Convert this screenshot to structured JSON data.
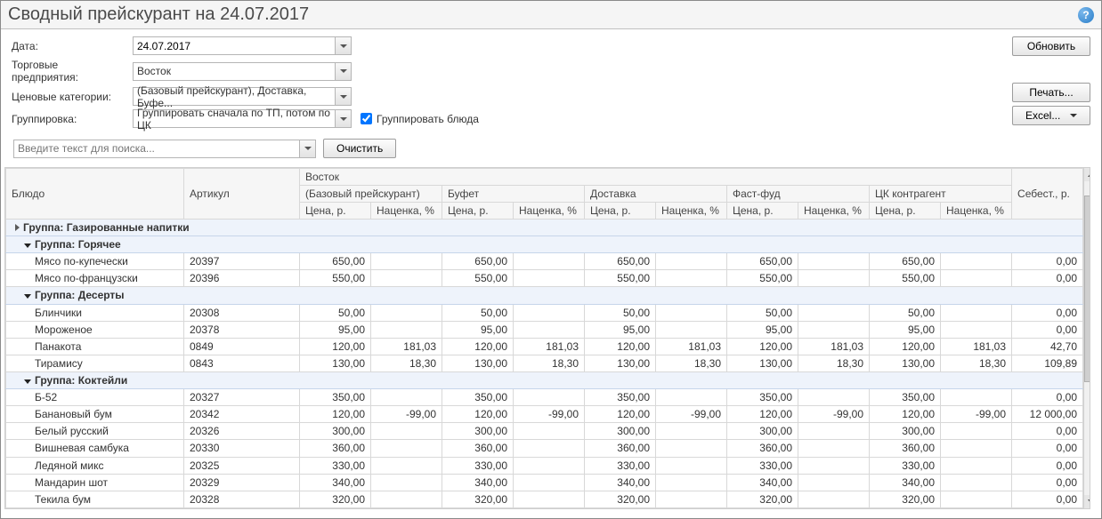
{
  "title": "Сводный прейскурант на 24.07.2017",
  "filters": {
    "date_label": "Дата:",
    "date_value": "24.07.2017",
    "enterprise_label": "Торговые предприятия:",
    "enterprise_value": "Восток",
    "pricecat_label": "Ценовые категории:",
    "pricecat_value": "(Базовый прейскурант), Доставка, Буфе...",
    "grouping_label": "Группировка:",
    "grouping_value": "Группировать сначала по ТП, потом по ЦК",
    "group_dishes_label": "Группировать блюда"
  },
  "buttons": {
    "refresh": "Обновить",
    "print": "Печать...",
    "excel": "Excel...",
    "clear": "Очистить"
  },
  "search": {
    "placeholder": "Введите текст для поиска..."
  },
  "headers": {
    "dish": "Блюдо",
    "sku": "Артикул",
    "enterprise": "Восток",
    "categories": [
      "(Базовый прейскурант)",
      "Буфет",
      "Доставка",
      "Фаст-фуд",
      "ЦК контрагент"
    ],
    "price": "Цена, р.",
    "markup": "Наценка, %",
    "cost": "Себест., р."
  },
  "groups": [
    {
      "collapsed": true,
      "label": "Группа: Газированные напитки",
      "rows": []
    },
    {
      "collapsed": false,
      "label": "Группа: Горячее",
      "rows": [
        {
          "name": "Мясо по-купечески",
          "sku": "20397",
          "p": [
            "650,00",
            "",
            "650,00",
            "",
            "650,00",
            "",
            "650,00",
            "",
            "650,00",
            ""
          ],
          "cost": "0,00"
        },
        {
          "name": "Мясо по-французски",
          "sku": "20396",
          "p": [
            "550,00",
            "",
            "550,00",
            "",
            "550,00",
            "",
            "550,00",
            "",
            "550,00",
            ""
          ],
          "cost": "0,00"
        }
      ]
    },
    {
      "collapsed": false,
      "label": "Группа: Десерты",
      "rows": [
        {
          "name": "Блинчики",
          "sku": "20308",
          "p": [
            "50,00",
            "",
            "50,00",
            "",
            "50,00",
            "",
            "50,00",
            "",
            "50,00",
            ""
          ],
          "cost": "0,00"
        },
        {
          "name": "Мороженое",
          "sku": "20378",
          "p": [
            "95,00",
            "",
            "95,00",
            "",
            "95,00",
            "",
            "95,00",
            "",
            "95,00",
            ""
          ],
          "cost": "0,00"
        },
        {
          "name": "Панакота",
          "sku": "0849",
          "p": [
            "120,00",
            "181,03",
            "120,00",
            "181,03",
            "120,00",
            "181,03",
            "120,00",
            "181,03",
            "120,00",
            "181,03"
          ],
          "cost": "42,70"
        },
        {
          "name": "Тирамису",
          "sku": "0843",
          "p": [
            "130,00",
            "18,30",
            "130,00",
            "18,30",
            "130,00",
            "18,30",
            "130,00",
            "18,30",
            "130,00",
            "18,30"
          ],
          "cost": "109,89"
        }
      ]
    },
    {
      "collapsed": false,
      "label": "Группа: Коктейли",
      "rows": [
        {
          "name": "Б-52",
          "sku": "20327",
          "p": [
            "350,00",
            "",
            "350,00",
            "",
            "350,00",
            "",
            "350,00",
            "",
            "350,00",
            ""
          ],
          "cost": "0,00"
        },
        {
          "name": "Банановый бум",
          "sku": "20342",
          "p": [
            "120,00",
            "-99,00",
            "120,00",
            "-99,00",
            "120,00",
            "-99,00",
            "120,00",
            "-99,00",
            "120,00",
            "-99,00"
          ],
          "cost": "12 000,00"
        },
        {
          "name": "Белый русский",
          "sku": "20326",
          "p": [
            "300,00",
            "",
            "300,00",
            "",
            "300,00",
            "",
            "300,00",
            "",
            "300,00",
            ""
          ],
          "cost": "0,00"
        },
        {
          "name": "Вишневая самбука",
          "sku": "20330",
          "p": [
            "360,00",
            "",
            "360,00",
            "",
            "360,00",
            "",
            "360,00",
            "",
            "360,00",
            ""
          ],
          "cost": "0,00"
        },
        {
          "name": "Ледяной микс",
          "sku": "20325",
          "p": [
            "330,00",
            "",
            "330,00",
            "",
            "330,00",
            "",
            "330,00",
            "",
            "330,00",
            ""
          ],
          "cost": "0,00"
        },
        {
          "name": "Мандарин шот",
          "sku": "20329",
          "p": [
            "340,00",
            "",
            "340,00",
            "",
            "340,00",
            "",
            "340,00",
            "",
            "340,00",
            ""
          ],
          "cost": "0,00"
        },
        {
          "name": "Текила бум",
          "sku": "20328",
          "p": [
            "320,00",
            "",
            "320,00",
            "",
            "320,00",
            "",
            "320,00",
            "",
            "320,00",
            ""
          ],
          "cost": "0,00"
        }
      ]
    }
  ]
}
